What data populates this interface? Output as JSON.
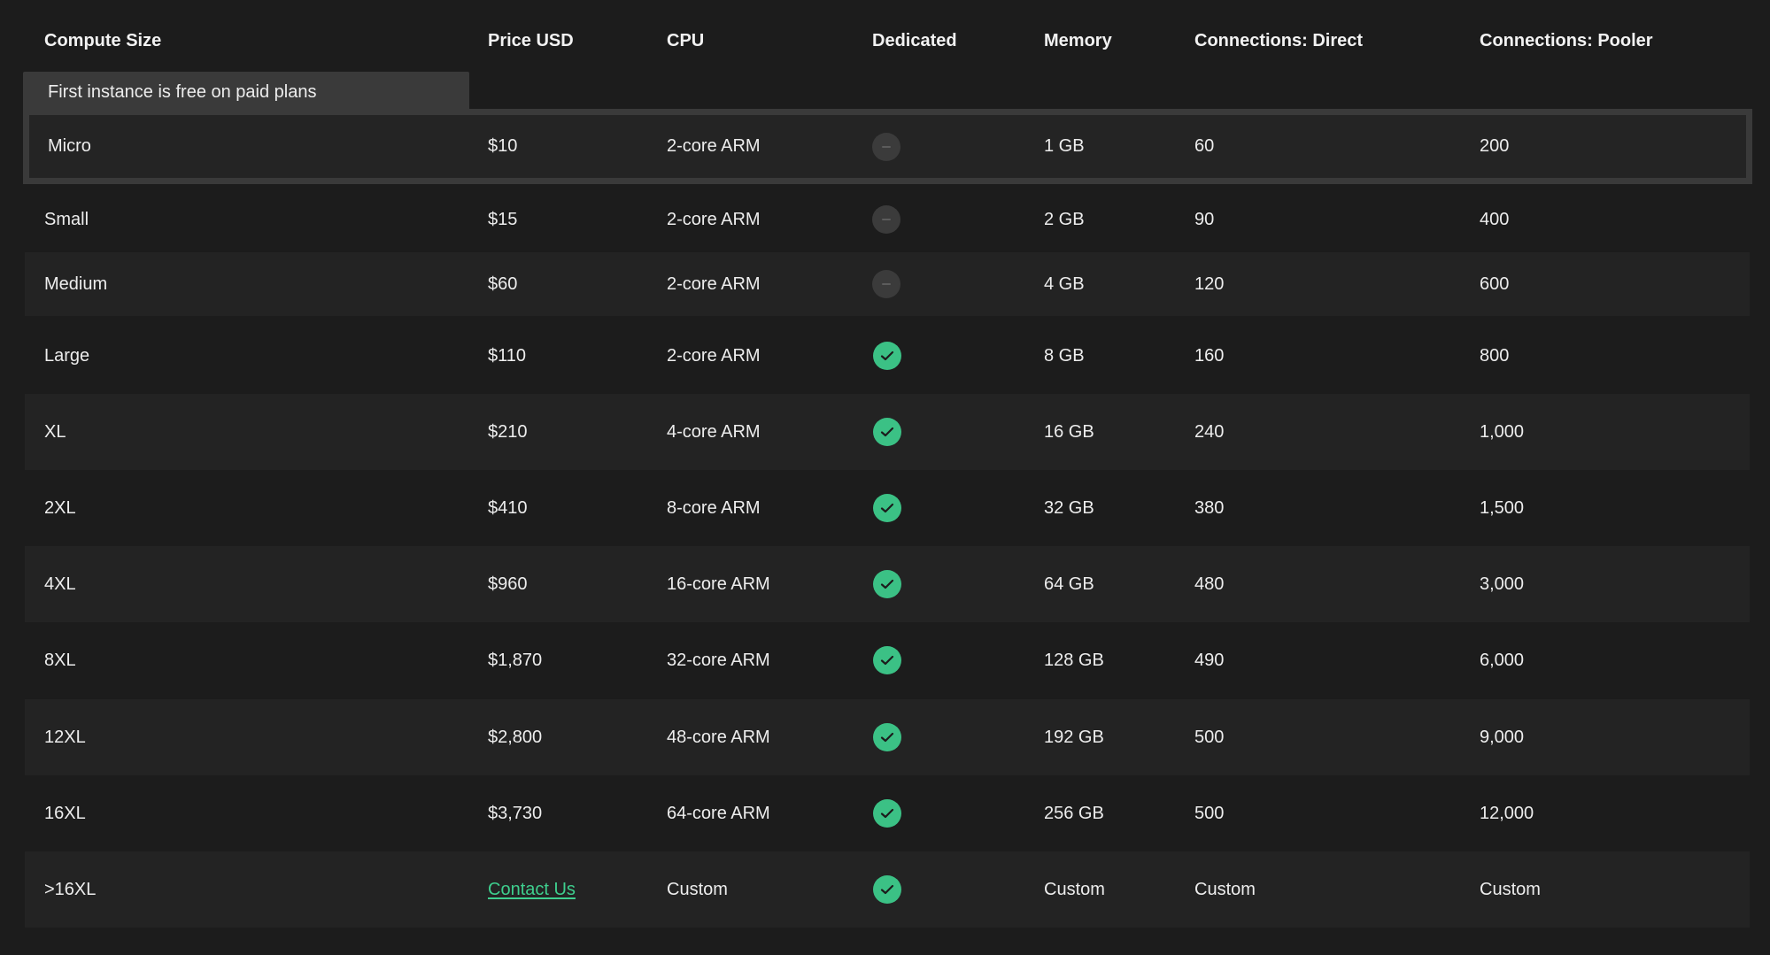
{
  "header": {
    "compute_size": "Compute Size",
    "price": "Price USD",
    "cpu": "CPU",
    "dedicated": "Dedicated",
    "memory": "Memory",
    "conn_direct": "Connections: Direct",
    "conn_pooler": "Connections: Pooler"
  },
  "banner": "First instance is free on paid plans",
  "colors": {
    "accent": "#3ecf8e",
    "background": "#1c1c1c"
  },
  "rows": [
    {
      "size": "Micro",
      "price": "$10",
      "cpu": "2-core ARM",
      "dedicated": false,
      "memory": "1 GB",
      "direct": "60",
      "pooler": "200"
    },
    {
      "size": "Small",
      "price": "$15",
      "cpu": "2-core ARM",
      "dedicated": false,
      "memory": "2 GB",
      "direct": "90",
      "pooler": "400"
    },
    {
      "size": "Medium",
      "price": "$60",
      "cpu": "2-core ARM",
      "dedicated": false,
      "memory": "4 GB",
      "direct": "120",
      "pooler": "600"
    },
    {
      "size": "Large",
      "price": "$110",
      "cpu": "2-core ARM",
      "dedicated": true,
      "memory": "8 GB",
      "direct": "160",
      "pooler": "800"
    },
    {
      "size": "XL",
      "price": "$210",
      "cpu": "4-core ARM",
      "dedicated": true,
      "memory": "16 GB",
      "direct": "240",
      "pooler": "1,000"
    },
    {
      "size": "2XL",
      "price": "$410",
      "cpu": "8-core ARM",
      "dedicated": true,
      "memory": "32 GB",
      "direct": "380",
      "pooler": "1,500"
    },
    {
      "size": "4XL",
      "price": "$960",
      "cpu": "16-core ARM",
      "dedicated": true,
      "memory": "64 GB",
      "direct": "480",
      "pooler": "3,000"
    },
    {
      "size": "8XL",
      "price": "$1,870",
      "cpu": "32-core ARM",
      "dedicated": true,
      "memory": "128 GB",
      "direct": "490",
      "pooler": "6,000"
    },
    {
      "size": "12XL",
      "price": "$2,800",
      "cpu": "48-core ARM",
      "dedicated": true,
      "memory": "192 GB",
      "direct": "500",
      "pooler": "9,000"
    },
    {
      "size": "16XL",
      "price": "$3,730",
      "cpu": "64-core ARM",
      "dedicated": true,
      "memory": "256 GB",
      "direct": "500",
      "pooler": "12,000"
    },
    {
      "size": ">16XL",
      "price": "Contact Us",
      "cpu": "Custom",
      "dedicated": true,
      "memory": "Custom",
      "direct": "Custom",
      "pooler": "Custom"
    }
  ]
}
